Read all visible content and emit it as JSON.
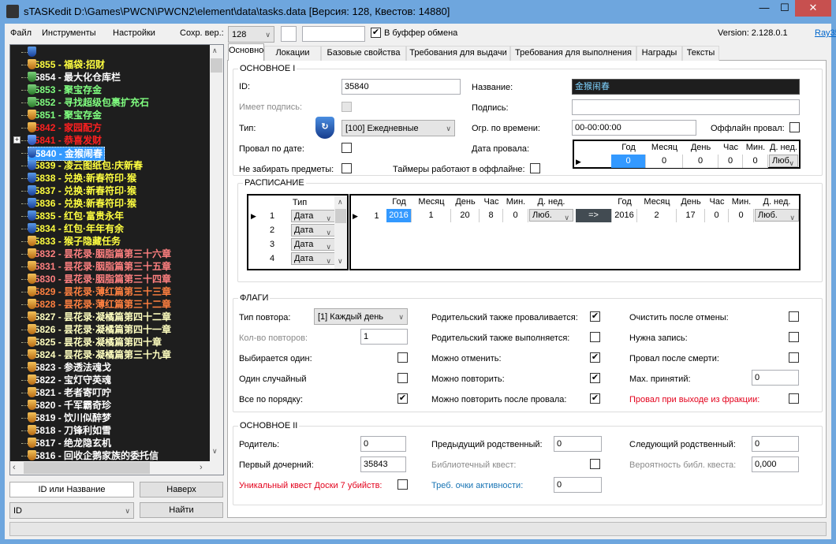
{
  "window": {
    "title": "sTASKedit D:\\Games\\PWCN\\PWCN2\\element\\data\\tasks.data [Версия: 128, Квестов: 14880]",
    "minimize": "—",
    "maximize": "☐",
    "close": "✕"
  },
  "menu": {
    "file": "Файл",
    "tools": "Инструменты",
    "settings": "Настройки",
    "save_ver_label": "Сохр. вер.:",
    "save_ver_value": "128",
    "clipboard_label": "В буффер обмена",
    "clipboard_checked": true,
    "version": "Version: 2.128.0.1",
    "author_link": "Ray35®"
  },
  "tree": {
    "items": [
      {
        "label": "35855 - 福袋:招财",
        "color": "#ffff40",
        "icon": "blue"
      },
      {
        "label": "35854 - 最大化仓库栏",
        "color": "#ffffff",
        "icon": "orange"
      },
      {
        "label": "35853 - 聚宝存金",
        "color": "#80ff80",
        "icon": "green"
      },
      {
        "label": "35852 - 寻找超级包裹扩充石",
        "color": "#80ff80",
        "icon": "green"
      },
      {
        "label": "35851 - 聚宝存金",
        "color": "#80ff80",
        "icon": "green"
      },
      {
        "label": "35842 - 家园配方",
        "color": "#ff2020",
        "icon": "orange"
      },
      {
        "label": "35841 - 恭喜发财",
        "color": "#ff2020",
        "icon": "orange"
      },
      {
        "label": "35840 - 金猴闹春",
        "color": "#ffffff",
        "icon": "daily",
        "selected": true
      },
      {
        "label": "35839 - 凌云图纸包:庆新春",
        "color": "#ffff40",
        "icon": "blue"
      },
      {
        "label": "35838 - 兑换:新春符印·猴",
        "color": "#ffff40",
        "icon": "blue"
      },
      {
        "label": "35837 - 兑换:新春符印·猴",
        "color": "#ffff40",
        "icon": "blue"
      },
      {
        "label": "35836 - 兑换:新春符印·猴",
        "color": "#ffff40",
        "icon": "blue"
      },
      {
        "label": "35835 - 红包·富贵永年",
        "color": "#ffff40",
        "icon": "blue"
      },
      {
        "label": "35834 - 红包·年年有余",
        "color": "#ffff40",
        "icon": "blue"
      },
      {
        "label": "35833 - 猴子隐藏任务",
        "color": "#ffff40",
        "icon": "blue"
      },
      {
        "label": "35832 - 昙花录·胭脂篇第三十六章",
        "color": "#ff8080",
        "icon": "orange"
      },
      {
        "label": "35831 - 昙花录·胭脂篇第三十五章",
        "color": "#ff8080",
        "icon": "orange"
      },
      {
        "label": "35830 - 昙花录·胭脂篇第三十四章",
        "color": "#ff8080",
        "icon": "orange"
      },
      {
        "label": "35829 - 昙花录·薄红篇第三十三章",
        "color": "#ff8040",
        "icon": "orange"
      },
      {
        "label": "35828 - 昙花录·薄红篇第三十二章",
        "color": "#ff8040",
        "icon": "orange"
      },
      {
        "label": "35827 - 昙花录·凝橘篇第四十二章",
        "color": "#ffffc0",
        "icon": "orange"
      },
      {
        "label": "35826 - 昙花录·凝橘篇第四十一章",
        "color": "#ffffc0",
        "icon": "orange"
      },
      {
        "label": "35825 - 昙花录·凝橘篇第四十章",
        "color": "#ffffc0",
        "icon": "orange"
      },
      {
        "label": "35824 - 昙花录·凝橘篇第三十九章",
        "color": "#ffffc0",
        "icon": "orange"
      },
      {
        "label": "35823 - 参透法魂戈",
        "color": "#ffffff",
        "icon": "orange"
      },
      {
        "label": "35822 - 宝灯守英魂",
        "color": "#ffffff",
        "icon": "orange"
      },
      {
        "label": "35821 - 老者寄叮咛",
        "color": "#ffffff",
        "icon": "orange"
      },
      {
        "label": "35820 - 千军霸奇珍",
        "color": "#ffffff",
        "icon": "orange"
      },
      {
        "label": "35819 - 饮川似醉梦",
        "color": "#ffffff",
        "icon": "orange"
      },
      {
        "label": "35818 - 刀锋利如雪",
        "color": "#ffffff",
        "icon": "orange"
      },
      {
        "label": "35817 - 绝龙隐玄机",
        "color": "#ffffff",
        "icon": "orange"
      },
      {
        "label": "35816 - 回收企鹅家族的委托信",
        "color": "#ffffff",
        "icon": "orange"
      },
      {
        "label": "35815 - 勇者礼包",
        "color": "#ffffff",
        "icon": "orange"
      }
    ]
  },
  "search": {
    "mode_button": "ID или Название",
    "top_button": "Наверх",
    "field_combo": "ID",
    "find_button": "Найти"
  },
  "tabs": [
    "Основное",
    "Локации",
    "Базовые свойства",
    "Требования для выдачи",
    "Требования для выполнения",
    "Награды",
    "Тексты"
  ],
  "main1": {
    "title": "ОСНОВНОЕ I",
    "id_label": "ID:",
    "id_value": "35840",
    "name_label": "Название:",
    "name_value": "金猴闹春",
    "has_sign_label": "Имеет подпись:",
    "sign_label": "Подпись:",
    "sign_value": "",
    "type_label": "Тип:",
    "type_value": "[100] Ежедневные",
    "time_limit_label": "Огр. по времени:",
    "time_limit_value": "00-00:00:00",
    "offline_fail_label": "Оффлайн провал:",
    "fail_by_date_label": "Провал по дате:",
    "fail_date_label": "Дата провала:",
    "no_take_items_label": "Не забирать предметы:",
    "timers_offline_label": "Таймеры работают в оффлайне:",
    "fail_date_grid": {
      "headers": [
        "Год",
        "Месяц",
        "День",
        "Час",
        "Мин.",
        "Д. нед."
      ],
      "row": [
        "0",
        "0",
        "0",
        "0",
        "0",
        "Люб."
      ]
    }
  },
  "schedule": {
    "title": "РАСПИСАНИЕ",
    "type_header": "Тип",
    "type_rows": [
      {
        "n": "1",
        "t": "Дата"
      },
      {
        "n": "2",
        "t": "Дата"
      },
      {
        "n": "3",
        "t": "Дата"
      },
      {
        "n": "4",
        "t": "Дата"
      }
    ],
    "headers": [
      "Год",
      "Месяц",
      "День",
      "Час",
      "Мин.",
      "Д. нед."
    ],
    "row_num": "1",
    "start": [
      "2016",
      "1",
      "20",
      "8",
      "0",
      "Люб."
    ],
    "arrow": "=>",
    "end": [
      "2016",
      "2",
      "17",
      "0",
      "0",
      "Люб."
    ]
  },
  "flags": {
    "title": "ФЛАГИ",
    "repeat_type_label": "Тип повтора:",
    "repeat_type_value": "[1] Каждый день",
    "repeat_count_label": "Кол-во повторов:",
    "repeat_count_value": "1",
    "choose_one_label": "Выбирается один:",
    "one_random_label": "Один случайный",
    "all_in_order_label": "Все по порядку:",
    "parent_fails_label": "Родительский также проваливается:",
    "parent_completes_label": "Родительский также выполняется:",
    "can_cancel_label": "Можно отменить:",
    "can_repeat_label": "Можно повторить:",
    "repeat_after_fail_label": "Можно повторить после провала:",
    "clear_after_cancel_label": "Очистить после отмены:",
    "need_record_label": "Нужна запись:",
    "fail_after_death_label": "Провал после смерти:",
    "max_accepted_label": "Max. принятий:",
    "max_accepted_value": "0",
    "fail_leave_faction_label": "Провал при выходе из фракции:",
    "checks": {
      "choose_one": false,
      "one_random": false,
      "all_in_order": true,
      "parent_fails": true,
      "parent_completes": false,
      "can_cancel": true,
      "can_repeat": true,
      "repeat_after_fail": true,
      "clear_after_cancel": false,
      "need_record": false,
      "fail_after_death": false,
      "fail_leave_faction": false
    }
  },
  "main2": {
    "title": "ОСНОВНОЕ II",
    "parent_label": "Родитель:",
    "parent_value": "0",
    "first_child_label": "Первый дочерний:",
    "first_child_value": "35843",
    "unique_label": "Уникальный квест Доски 7 убийств:",
    "prev_label": "Предыдущий родственный:",
    "prev_value": "0",
    "library_label": "Библиотечный квест:",
    "activity_label": "Треб. очки активности:",
    "activity_value": "0",
    "next_label": "Следующий родственный:",
    "next_value": "0",
    "lib_prob_label": "Вероятность библ. квеста:",
    "lib_prob_value": "0,000"
  }
}
